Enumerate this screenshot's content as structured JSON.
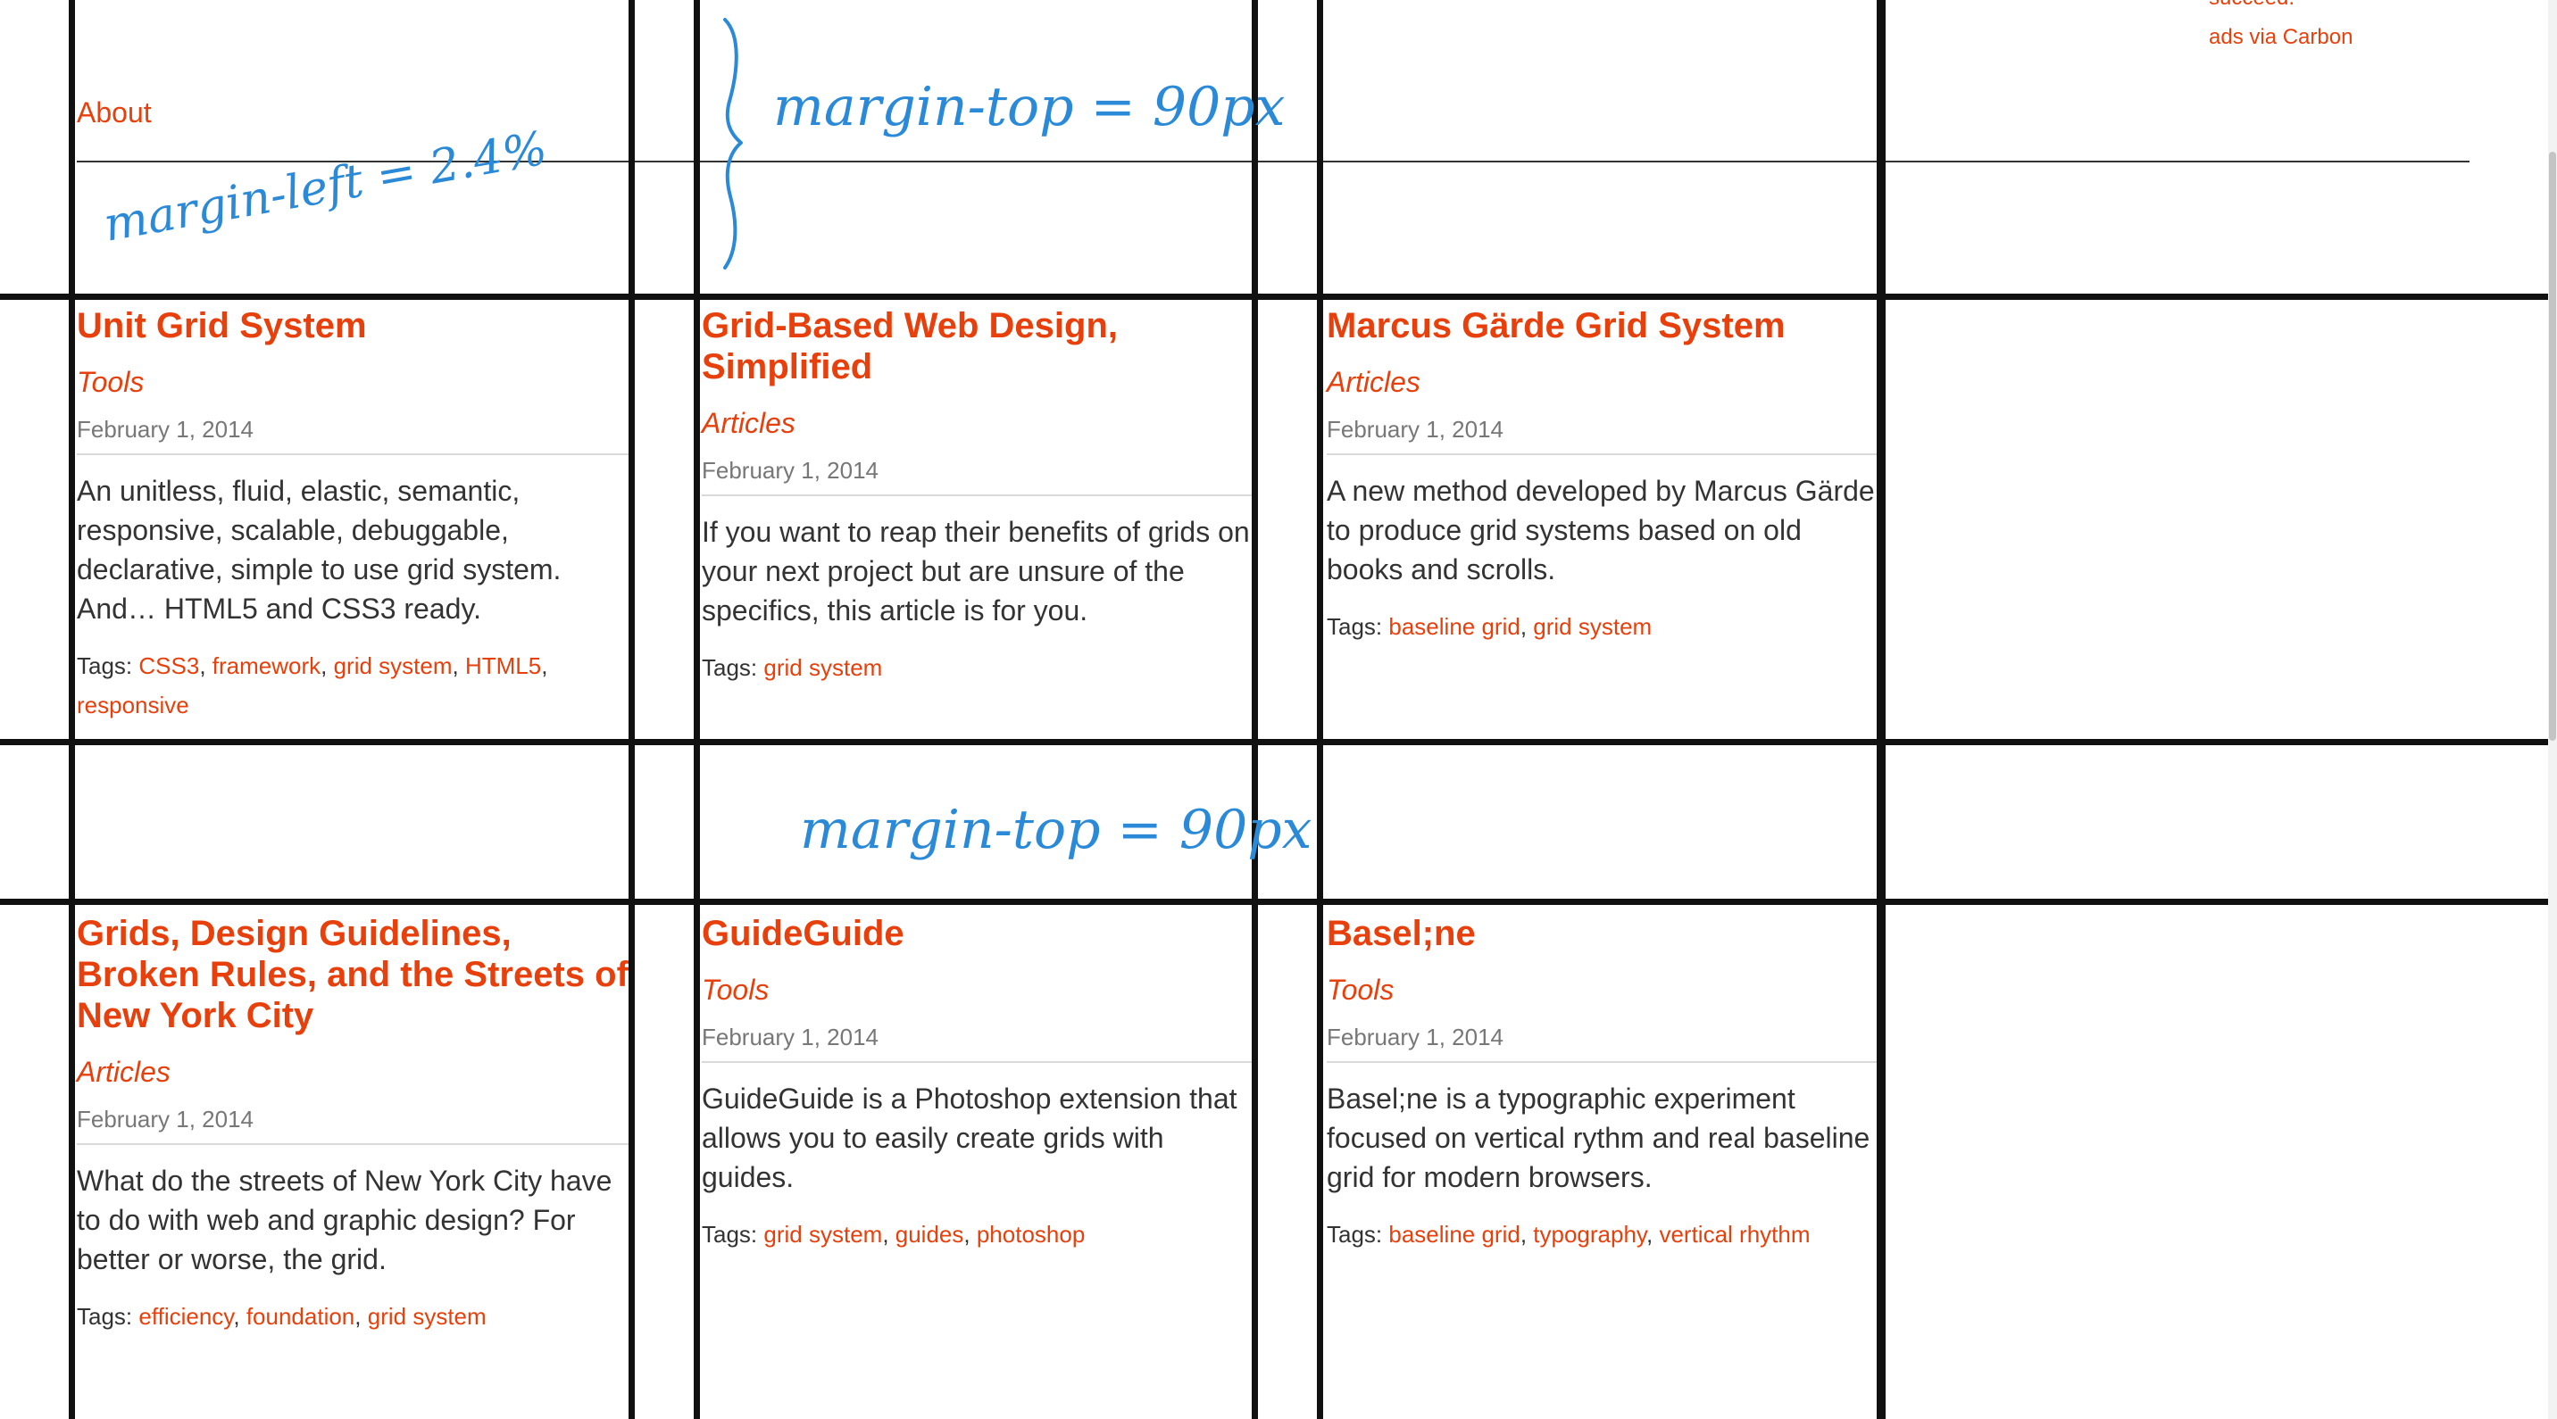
{
  "nav": {
    "about_label": "About"
  },
  "ad": {
    "partial_text": "succeed.",
    "carbon_label": "ads via Carbon"
  },
  "cards": [
    {
      "title": "Unit Grid System",
      "category": "Tools",
      "date": "February 1, 2014",
      "description": "An unitless, fluid, elastic, semantic, responsive, scalable, debuggable, declarative, simple to use grid system. And… HTML5 and CSS3 ready.",
      "tags_label": "Tags:",
      "tags": [
        "CSS3",
        "framework",
        "grid system",
        "HTML5",
        "responsive"
      ]
    },
    {
      "title": "Grid-Based Web Design, Simplified",
      "category": "Articles",
      "date": "February 1, 2014",
      "description": "If you want to reap their benefits of grids on your next project but are unsure of the specifics, this article is for you.",
      "tags_label": "Tags:",
      "tags": [
        "grid system"
      ]
    },
    {
      "title": "Marcus Gärde Grid System",
      "category": "Articles",
      "date": "February 1, 2014",
      "description": "A new method developed by Marcus Gärde to produce grid systems based on old books and scrolls.",
      "tags_label": "Tags:",
      "tags": [
        "baseline grid",
        "grid system"
      ]
    },
    {
      "title": "Grids, Design Guidelines, Broken Rules, and the Streets of New York City",
      "category": "Articles",
      "date": "February 1, 2014",
      "description": "What do the streets of New York City have to do with web and graphic design? For better or worse, the grid.",
      "tags_label": "Tags:",
      "tags": [
        "efficiency",
        "foundation",
        "grid system"
      ]
    },
    {
      "title": "GuideGuide",
      "category": "Tools",
      "date": "February 1, 2014",
      "description": "GuideGuide is a Photoshop extension that allows you to easily create grids with guides.",
      "tags_label": "Tags:",
      "tags": [
        "grid system",
        "guides",
        "photoshop"
      ]
    },
    {
      "title": "Basel;ne",
      "category": "Tools",
      "date": "February 1, 2014",
      "description": "Basel;ne is a typographic experiment focused on vertical rythm and real baseline grid for modern browsers.",
      "tags_label": "Tags:",
      "tags": [
        "baseline grid",
        "typography",
        "vertical rhythm"
      ]
    }
  ],
  "annotations": {
    "margin_left": "margin-left = 2.4%",
    "margin_top_header": "margin-top = 90px",
    "margin_top_row": "margin-top = 90px"
  },
  "colors": {
    "accent": "#e8400c",
    "annotation": "#2a8ad8",
    "grid_line": "#111111"
  }
}
